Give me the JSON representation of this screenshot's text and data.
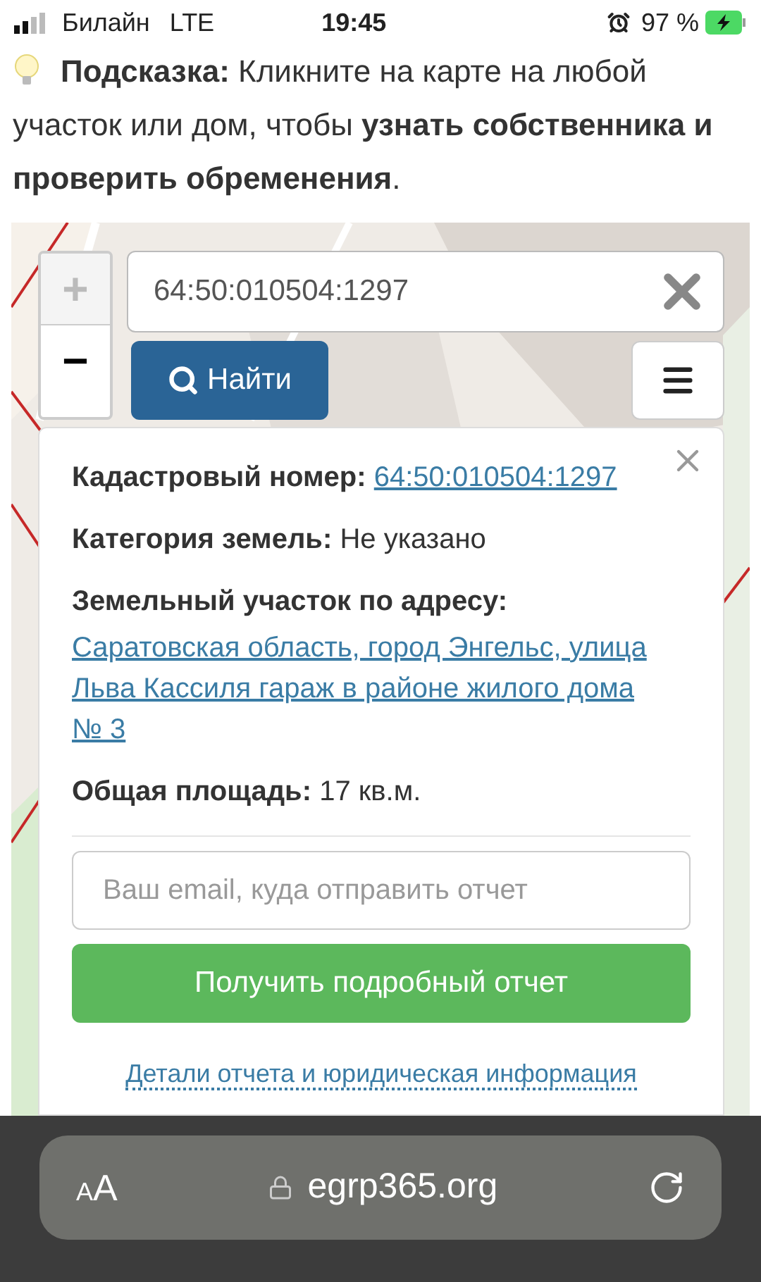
{
  "status_bar": {
    "carrier": "Билайн",
    "network": "LTE",
    "time": "19:45",
    "battery": "97 %"
  },
  "hint": {
    "text": "**Подсказка:** Кликните на карте на любой участок или дом, чтобы **узнать собственника и проверить обременения**."
  },
  "map": {
    "zoom": [
      {
        "label": "+",
        "disabled": true
      },
      {
        "label": "−",
        "disabled": false
      }
    ],
    "search": {
      "value": "64:50:010504:1297"
    },
    "find_button": "Найти",
    "popup": {
      "fields": [
        {
          "kind": "inline_link",
          "label": "Кадастровый номер:",
          "value": "64:50:010504:1297"
        },
        {
          "kind": "inline_text",
          "label": "Категория земель:",
          "value": "Не указано"
        },
        {
          "kind": "block_link",
          "label": "Земельный участок по адресу:",
          "value": "Саратовская область, город Энгельс, улица Льва Кассиля гараж в районе жилого дома № 3"
        },
        {
          "kind": "inline_text",
          "label": "Общая площадь:",
          "value": "17 кв.м."
        }
      ],
      "email": {
        "placeholder": "Ваш email, куда отправить отчет"
      },
      "report_button": "Получить подробный отчет",
      "details_link": "Детали отчета и юридическая информация"
    }
  },
  "browser": {
    "text_size": "AA",
    "url": "egrp365.org"
  }
}
